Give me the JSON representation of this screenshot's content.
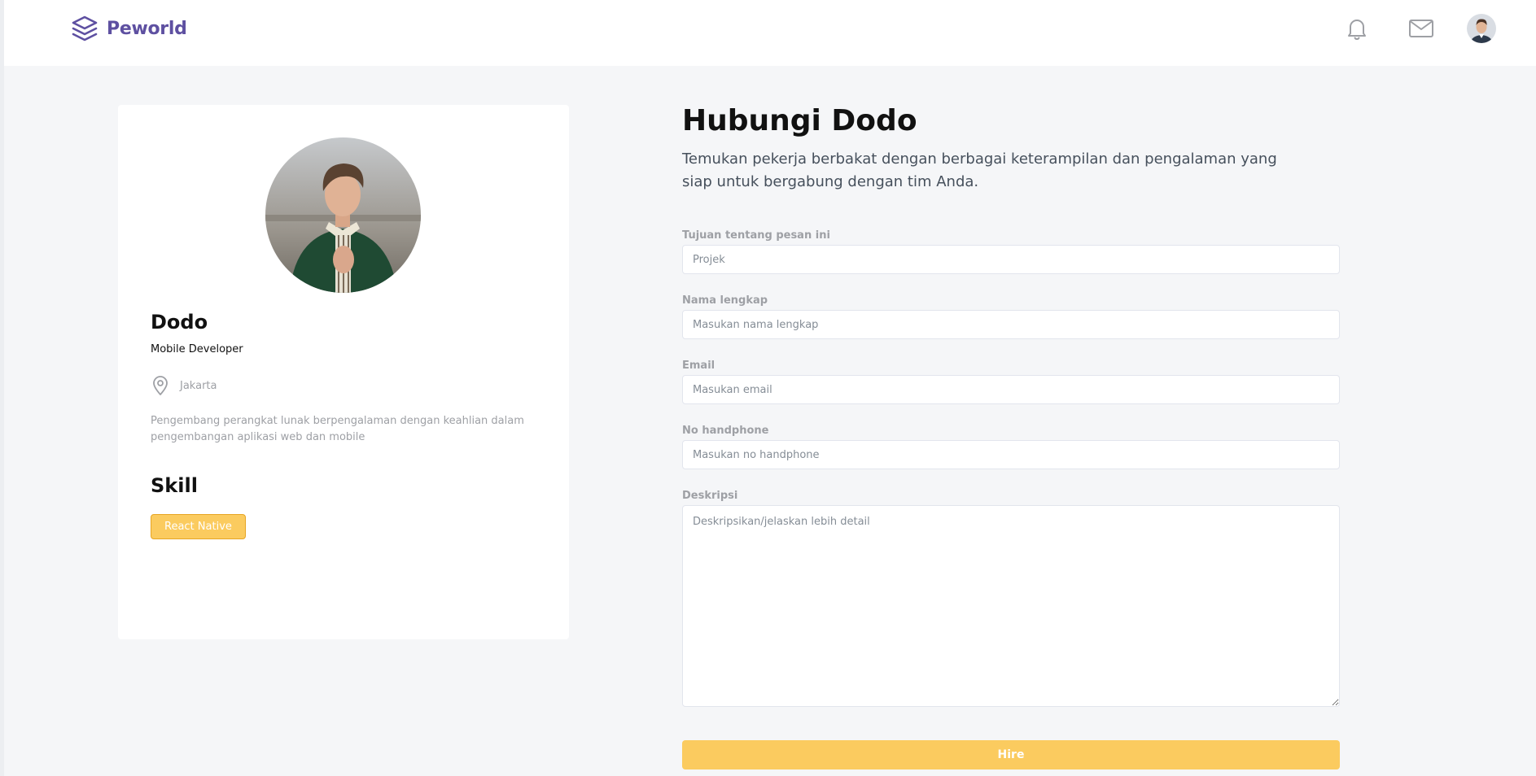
{
  "header": {
    "brand_name": "Peworld",
    "icons": [
      "bell-icon",
      "mail-icon",
      "user-avatar"
    ]
  },
  "profile": {
    "name": "Dodo",
    "role": "Mobile Developer",
    "location": "Jakarta",
    "bio": "Pengembang perangkat lunak berpengalaman dengan keahlian dalam pengembangan aplikasi web dan mobile",
    "skill_title": "Skill",
    "skills": [
      "React Native"
    ]
  },
  "contact": {
    "title": "Hubungi Dodo",
    "subtitle": "Temukan pekerja berbakat dengan berbagai keterampilan dan pengalaman yang siap untuk bergabung dengan tim Anda.",
    "fields": {
      "purpose": {
        "label": "Tujuan tentang pesan ini",
        "placeholder": "Projek"
      },
      "fullname": {
        "label": "Nama lengkap",
        "placeholder": "Masukan nama lengkap"
      },
      "email": {
        "label": "Email",
        "placeholder": "Masukan email"
      },
      "phone": {
        "label": "No handphone",
        "placeholder": "Masukan no handphone"
      },
      "description": {
        "label": "Deskripsi",
        "placeholder": "Deskripsikan/jelaskan lebih detail"
      }
    },
    "submit_label": "Hire"
  },
  "colors": {
    "brand": "#5e50a1",
    "accent": "#fbcb5f",
    "background": "#f5f6f8",
    "muted_text": "#9ea0a5"
  }
}
